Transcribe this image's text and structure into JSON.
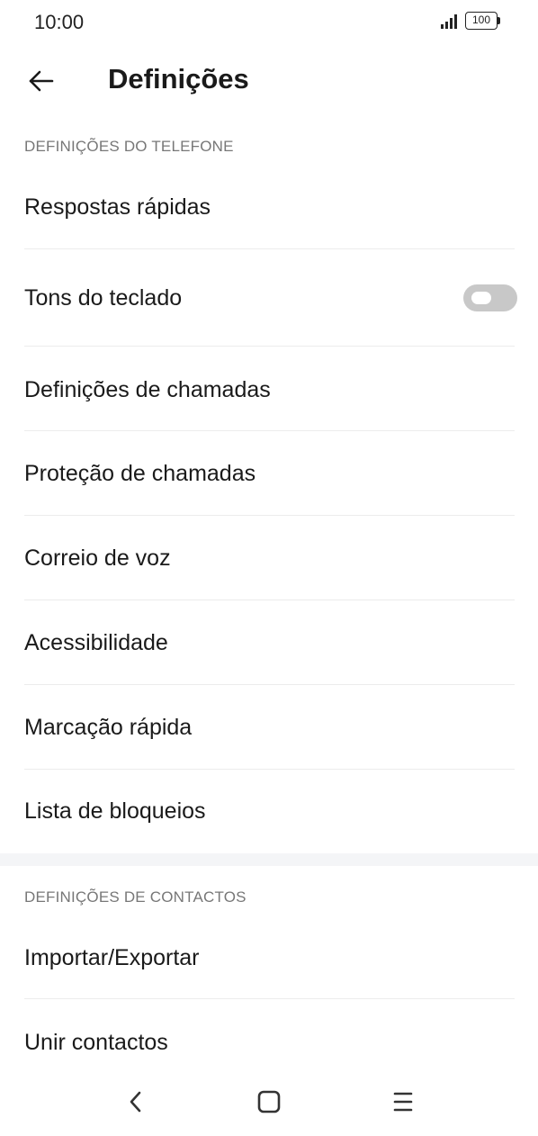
{
  "status_bar": {
    "time": "10:00",
    "battery_level": "100"
  },
  "app_bar": {
    "title": "Definições",
    "back_icon": "arrow-left-icon"
  },
  "sections": {
    "phone": {
      "header": "DEFINIÇÕES DO TELEFONE",
      "items": [
        {
          "label": "Respostas rápidas"
        },
        {
          "label": "Tons do teclado",
          "toggle": false
        },
        {
          "label": "Definições de chamadas"
        },
        {
          "label": "Proteção de chamadas"
        },
        {
          "label": "Correio de voz"
        },
        {
          "label": "Acessibilidade"
        },
        {
          "label": "Marcação rápida"
        },
        {
          "label": "Lista de bloqueios"
        }
      ]
    },
    "contacts": {
      "header": "DEFINIÇÕES DE CONTACTOS",
      "items": [
        {
          "label": "Importar/Exportar"
        },
        {
          "label": "Unir contactos"
        }
      ]
    }
  },
  "nav_bar": {
    "back_icon": "nav-back-icon",
    "home_icon": "nav-home-icon",
    "menu_icon": "nav-menu-icon"
  },
  "colors": {
    "toggle_off": "#c8c8c8",
    "section_header": "#777777",
    "divider": "#ececec",
    "section_gap": "#f4f5f7"
  }
}
